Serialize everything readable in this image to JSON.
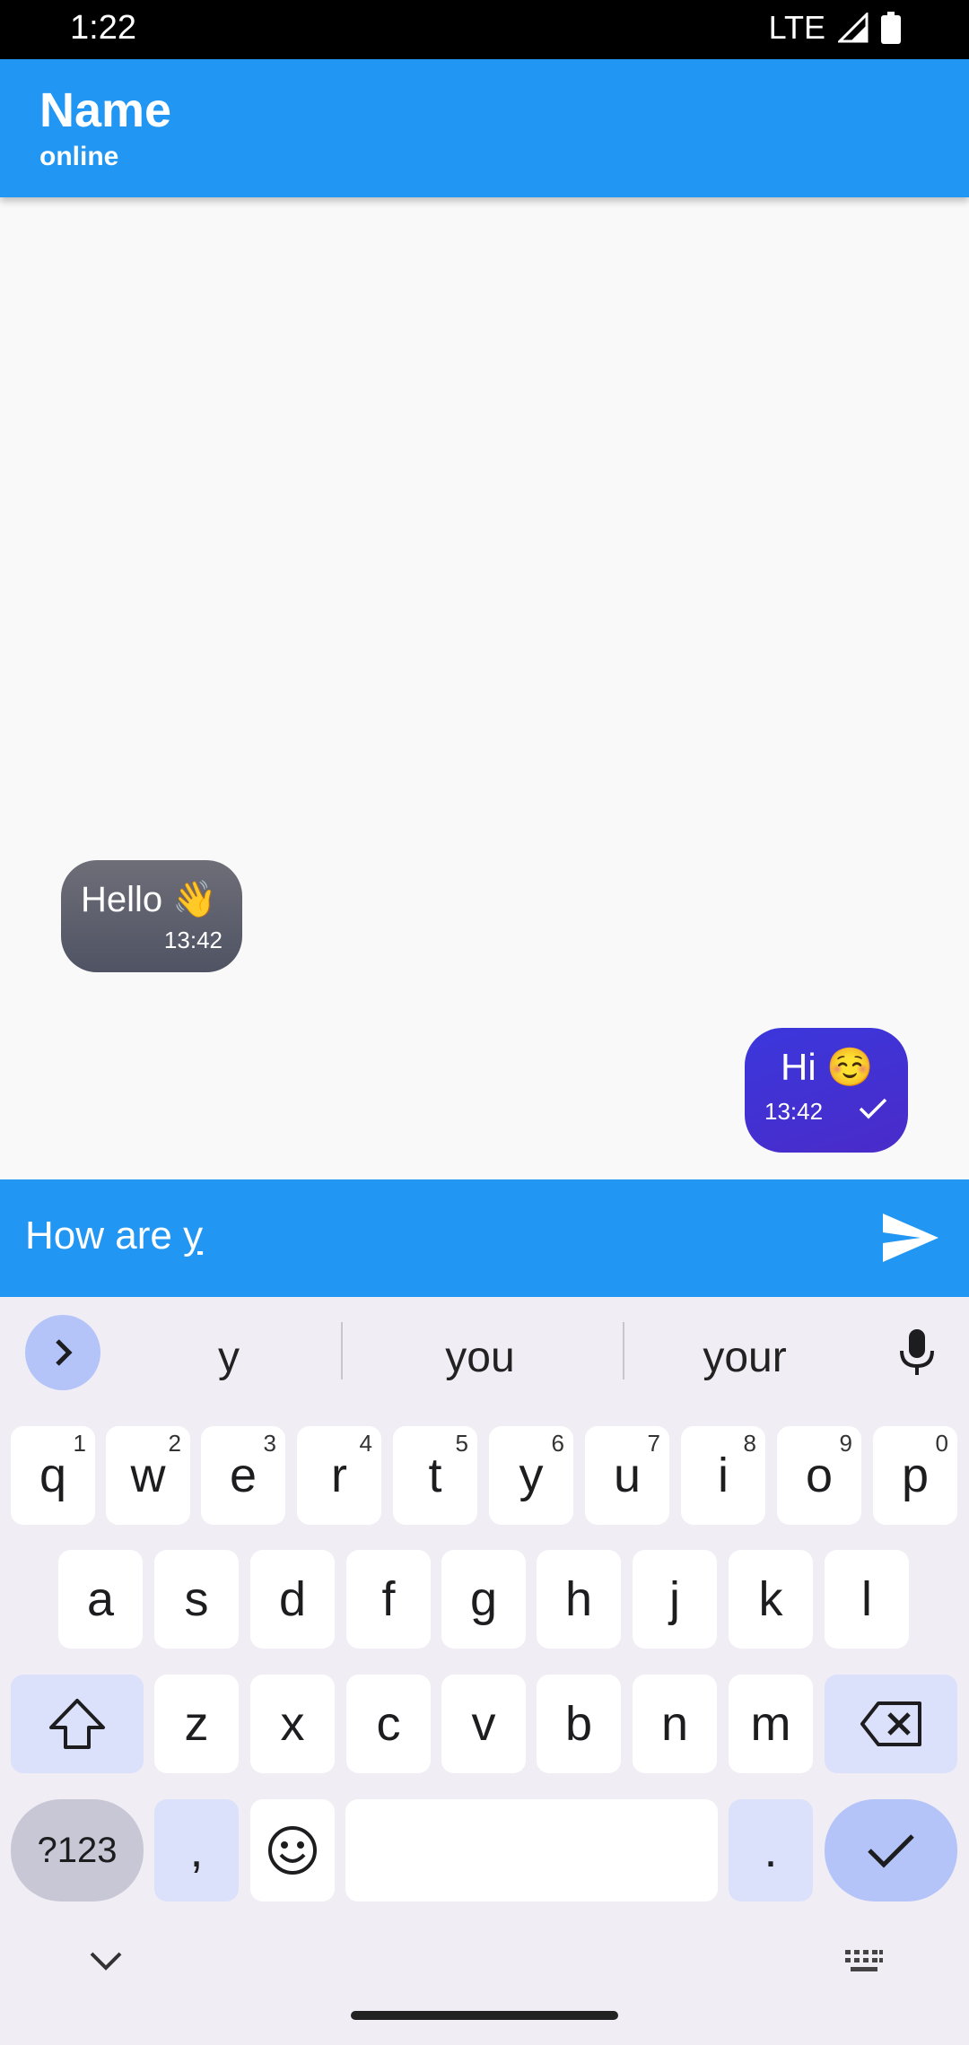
{
  "status_bar": {
    "time": "1:22",
    "network": "LTE"
  },
  "app_bar": {
    "title": "Name",
    "subtitle": "online"
  },
  "messages": [
    {
      "direction": "incoming",
      "text": "Hello 👋",
      "time": "13:42"
    },
    {
      "direction": "outgoing",
      "text": "Hi ☺️",
      "time": "13:42",
      "status": "sent"
    }
  ],
  "input": {
    "text_prefix": "How are ",
    "text_underlined": "y"
  },
  "keyboard": {
    "suggestions": [
      "y",
      "you",
      "your"
    ],
    "row1": [
      {
        "label": "q",
        "hint": "1"
      },
      {
        "label": "w",
        "hint": "2"
      },
      {
        "label": "e",
        "hint": "3"
      },
      {
        "label": "r",
        "hint": "4"
      },
      {
        "label": "t",
        "hint": "5"
      },
      {
        "label": "y",
        "hint": "6"
      },
      {
        "label": "u",
        "hint": "7"
      },
      {
        "label": "i",
        "hint": "8"
      },
      {
        "label": "o",
        "hint": "9"
      },
      {
        "label": "p",
        "hint": "0"
      }
    ],
    "row2": [
      "a",
      "s",
      "d",
      "f",
      "g",
      "h",
      "j",
      "k",
      "l"
    ],
    "row3": [
      "z",
      "x",
      "c",
      "v",
      "b",
      "n",
      "m"
    ],
    "symbols_label": "?123",
    "comma_label": ",",
    "period_label": "."
  },
  "colors": {
    "app_bar": "#2196f3",
    "incoming_bubble": "#5b5f6e",
    "outgoing_bubble": "#4330d4",
    "keyboard_bg": "#f1edf4"
  }
}
